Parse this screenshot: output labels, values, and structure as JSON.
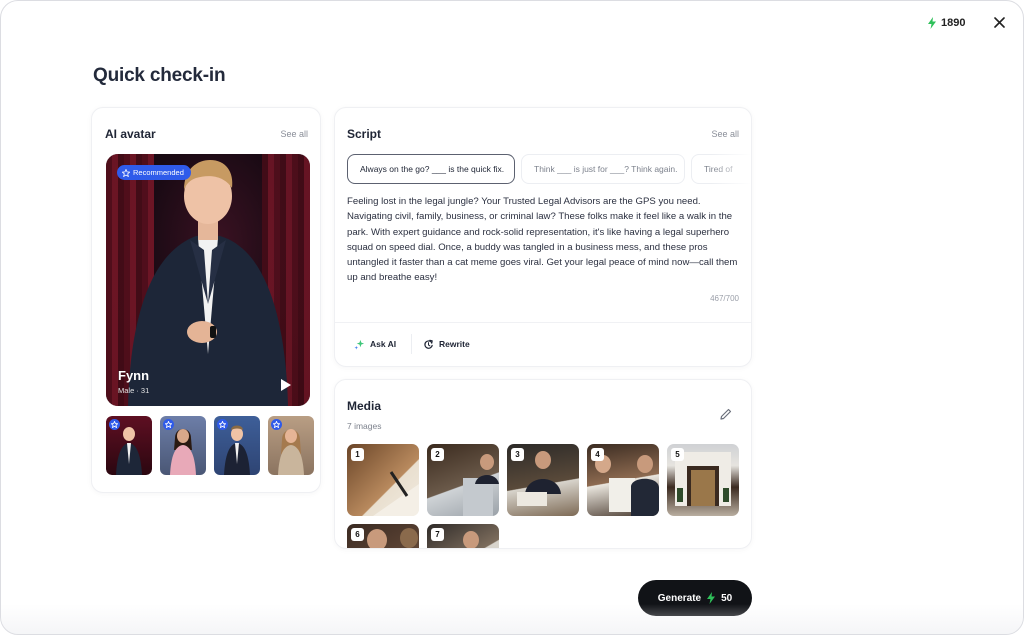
{
  "header": {
    "credits": "1890",
    "close_icon": "close-icon",
    "bolt_color": "#2fc05a"
  },
  "page": {
    "title": "Quick check-in"
  },
  "avatar_card": {
    "title": "AI avatar",
    "see_all": "See all",
    "badge": "Recommended",
    "name": "Fynn",
    "meta": "Male · 31",
    "play_icon": "play-icon",
    "thumbnails": [
      {
        "name": "avatar-thumb-1",
        "selected": true
      },
      {
        "name": "avatar-thumb-2",
        "selected": false
      },
      {
        "name": "avatar-thumb-3",
        "selected": false
      },
      {
        "name": "avatar-thumb-4",
        "selected": false
      }
    ]
  },
  "script_card": {
    "title": "Script",
    "see_all": "See all",
    "chips": [
      "Always on the go? ___ is the quick fix.",
      "Think ___ is just for ___? Think again.",
      "Tired of"
    ],
    "text": "Feeling lost in the legal jungle? Your Trusted Legal Advisors are the GPS you need. Navigating civil, family, business, or criminal law? These folks make it feel like a walk in the park. With expert guidance and rock-solid representation, it's like having a legal superhero squad on speed dial. Once, a buddy was tangled in a business mess, and these pros untangled it faster than a cat meme goes viral. Get your legal peace of mind now—call them up and breathe easy!",
    "char_count": "467/700",
    "ask_ai": "Ask AI",
    "rewrite": "Rewrite"
  },
  "media_card": {
    "title": "Media",
    "count": "7 images",
    "items": [
      "1",
      "2",
      "3",
      "4",
      "5",
      "6",
      "7"
    ]
  },
  "generate": {
    "label": "Generate",
    "cost": "50"
  }
}
